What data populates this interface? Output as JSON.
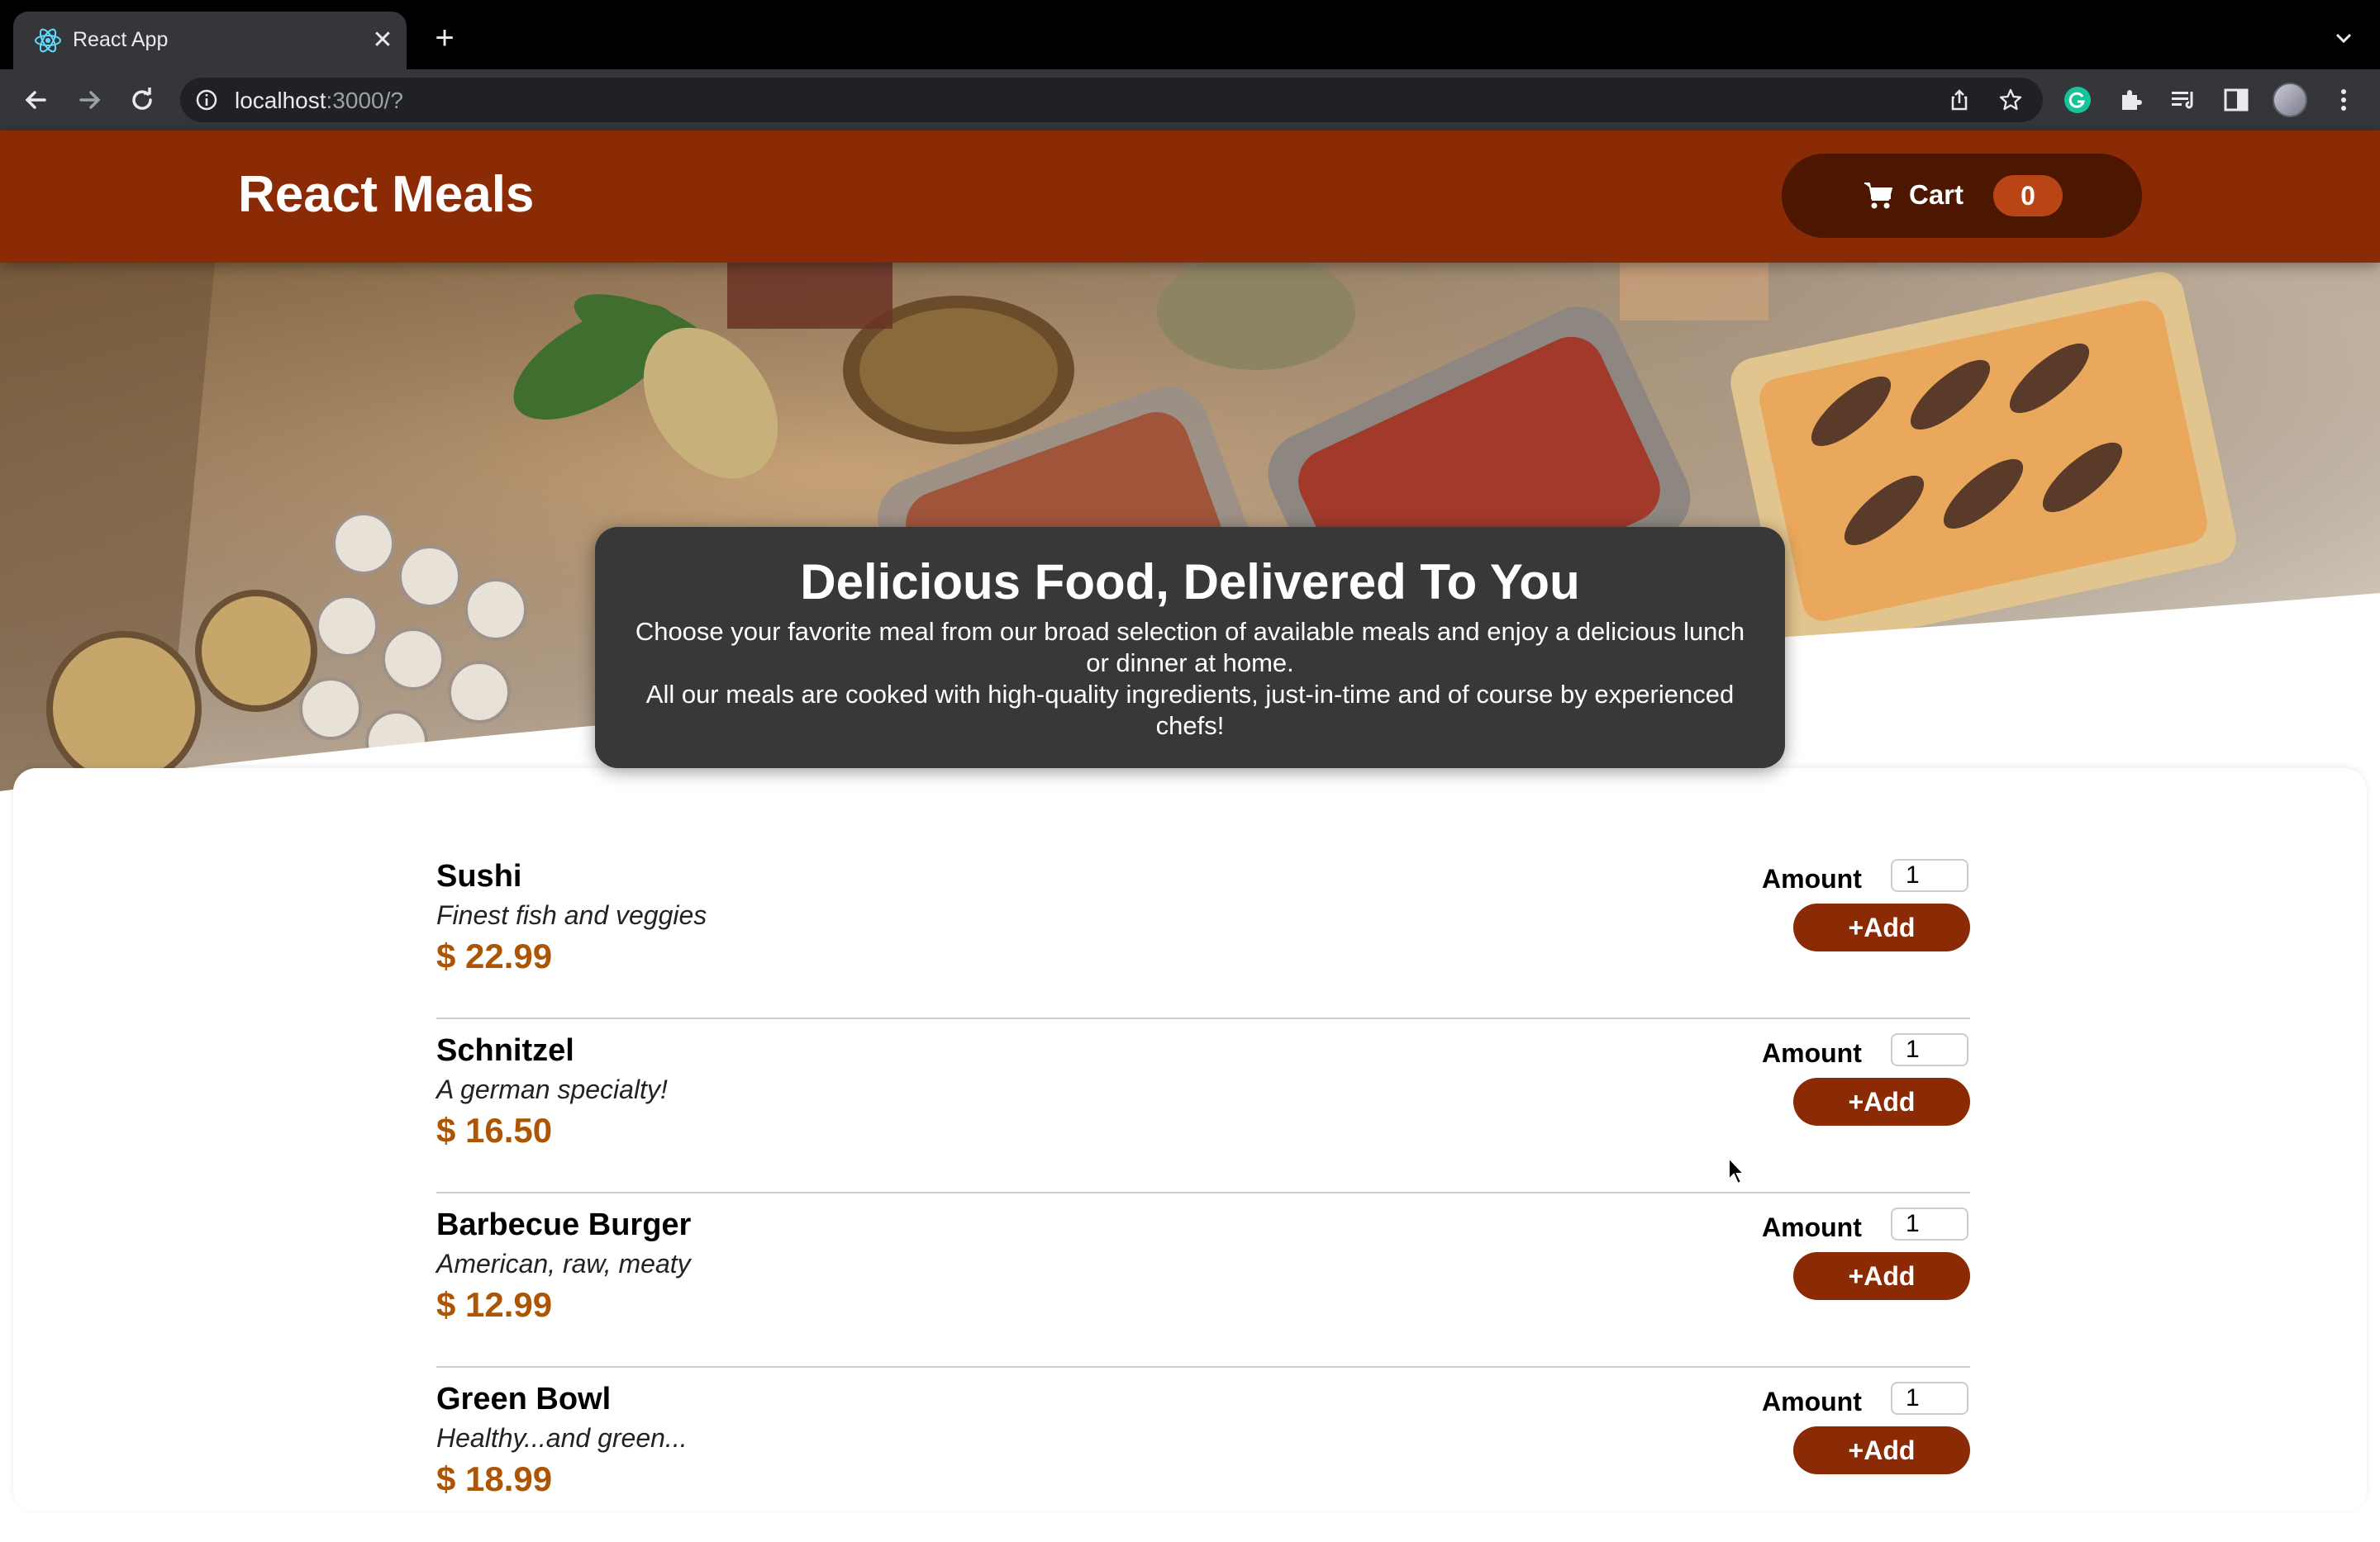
{
  "browser": {
    "tab_title": "React App",
    "url_host": "localhost",
    "url_path": ":3000/?",
    "icons": [
      "react-favicon",
      "close-icon",
      "plus-icon",
      "chevron-down-icon",
      "back-icon",
      "forward-icon",
      "reload-icon",
      "info-icon",
      "share-icon",
      "star-icon",
      "grammarly-icon",
      "extensions-icon",
      "reading-list-icon",
      "side-panel-icon",
      "avatar",
      "menu-icon"
    ]
  },
  "header": {
    "title": "React Meals",
    "cart_label": "Cart",
    "cart_count": "0",
    "colors": {
      "header_bg": "#8a2b06",
      "cart_bg": "#4d1601",
      "badge_bg": "#b94517"
    }
  },
  "summary": {
    "heading": "Delicious Food, Delivered To You",
    "paragraph1": "Choose your favorite meal from our broad selection of available meals and enjoy a delicious lunch or dinner at home.",
    "paragraph2": "All our meals are cooked with high-quality ingredients, just-in-time and of course by experienced chefs!"
  },
  "meals": [
    {
      "name": "Sushi",
      "description": "Finest fish and veggies",
      "price": "$ 22.99",
      "amount_label": "Amount",
      "amount": "1",
      "add_label": "+Add"
    },
    {
      "name": "Schnitzel",
      "description": "A german specialty!",
      "price": "$ 16.50",
      "amount_label": "Amount",
      "amount": "1",
      "add_label": "+Add"
    },
    {
      "name": "Barbecue Burger",
      "description": "American, raw, meaty",
      "price": "$ 12.99",
      "amount_label": "Amount",
      "amount": "1",
      "add_label": "+Add"
    },
    {
      "name": "Green Bowl",
      "description": "Healthy...and green...",
      "price": "$ 18.99",
      "amount_label": "Amount",
      "amount": "1",
      "add_label": "+Add"
    }
  ],
  "colors": {
    "accent": "#8a2b06",
    "price": "#ad5502",
    "summary_bg": "#383838"
  }
}
